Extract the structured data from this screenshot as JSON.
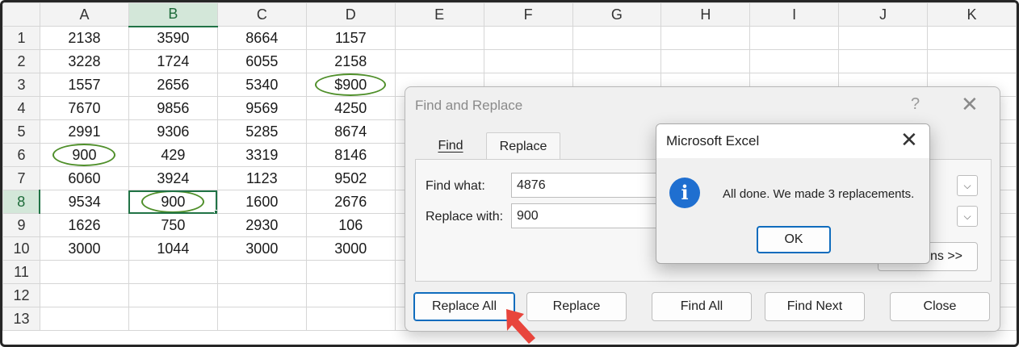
{
  "sheet": {
    "columns": [
      "A",
      "B",
      "C",
      "D",
      "E",
      "F",
      "G",
      "H",
      "I",
      "J",
      "K"
    ],
    "selected_column": "B",
    "selected_row": "8",
    "rows": [
      {
        "num": "1",
        "cells": [
          "2138",
          "3590",
          "8664",
          "1157"
        ]
      },
      {
        "num": "2",
        "cells": [
          "3228",
          "1724",
          "6055",
          "2158"
        ]
      },
      {
        "num": "3",
        "cells": [
          "1557",
          "2656",
          "5340",
          "$900"
        ]
      },
      {
        "num": "4",
        "cells": [
          "7670",
          "9856",
          "9569",
          "4250"
        ]
      },
      {
        "num": "5",
        "cells": [
          "2991",
          "9306",
          "5285",
          "8674"
        ]
      },
      {
        "num": "6",
        "cells": [
          "900",
          "429",
          "3319",
          "8146"
        ]
      },
      {
        "num": "7",
        "cells": [
          "6060",
          "3924",
          "1123",
          "9502"
        ]
      },
      {
        "num": "8",
        "cells": [
          "9534",
          "900",
          "1600",
          "2676"
        ]
      },
      {
        "num": "9",
        "cells": [
          "1626",
          "750",
          "2930",
          "106"
        ]
      },
      {
        "num": "10",
        "cells": [
          "3000",
          "1044",
          "3000",
          "3000"
        ]
      },
      {
        "num": "11",
        "cells": [
          "",
          "",
          "",
          ""
        ]
      },
      {
        "num": "12",
        "cells": [
          "",
          "",
          "",
          ""
        ]
      },
      {
        "num": "13",
        "cells": [
          "",
          "",
          "",
          ""
        ]
      }
    ],
    "accent_color": "#217346",
    "highlight_ring_color": "#4f8f2a"
  },
  "find_replace": {
    "title": "Find and Replace",
    "help": "?",
    "close": "✕",
    "tabs": {
      "find": "Find",
      "replace": "Replace"
    },
    "find_label": "Find what:",
    "find_value": "4876",
    "replace_label": "Replace with:",
    "replace_value": "900",
    "options_partial": "ns >>",
    "dropdown_icon": "⌵",
    "buttons": {
      "replace_all": "Replace All",
      "replace": "Replace",
      "find_all": "Find All",
      "find_next": "Find Next",
      "close": "Close"
    }
  },
  "message_box": {
    "title": "Microsoft Excel",
    "close": "✕",
    "icon": "i",
    "text": "All done. We made 3 replacements.",
    "ok": "OK"
  }
}
